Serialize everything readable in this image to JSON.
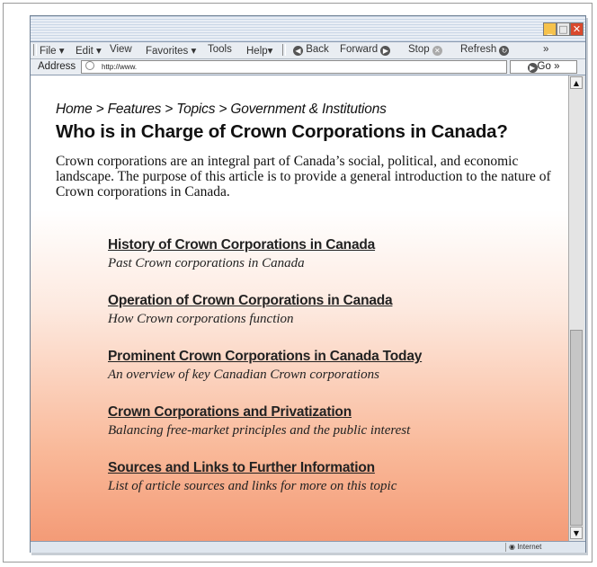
{
  "window": {
    "controls": {
      "minimize": "_",
      "maximize": "□",
      "close": "✕"
    }
  },
  "menu": {
    "file": "File ▾",
    "edit": "Edit ▾",
    "view": "View",
    "favorites": "Favorites ▾",
    "tools": "Tools",
    "help": "Help▾",
    "back": "Back",
    "forward": "Forward",
    "stop": "Stop",
    "refresh": "Refresh",
    "more": "»"
  },
  "address": {
    "label": "Address",
    "url": "http://www.",
    "go_label": "Go »"
  },
  "page": {
    "breadcrumb": "Home > Features > Topics > Government & Institutions",
    "title": "Who is in Charge of Crown Corporations in Canada?",
    "intro": "Crown corporations are an integral part of Canada’s social, political, and economic landscape.  The purpose of this article is to provide a general introduction to the nature of Crown corporations in Canada.",
    "sections": [
      {
        "title": "History of Crown Corporations in Canada",
        "desc": "Past Crown corporations in Canada"
      },
      {
        "title": "Operation of Crown Corporations in Canada",
        "desc": "How Crown corporations function"
      },
      {
        "title": "Prominent Crown Corporations in Canada Today",
        "desc": "An overview of key Canadian Crown corporations"
      },
      {
        "title": "Crown Corporations and Privatization",
        "desc": "Balancing free-market principles and the public interest"
      },
      {
        "title": "Sources and Links to Further Information",
        "desc": "List of article sources and links for more on this topic"
      }
    ]
  },
  "scroll": {
    "up": "▲",
    "down": "▼"
  },
  "status": {
    "zone": "Internet"
  },
  "colors": {
    "gradient_bottom": "#f49b77",
    "chrome": "#dfe6ee"
  }
}
